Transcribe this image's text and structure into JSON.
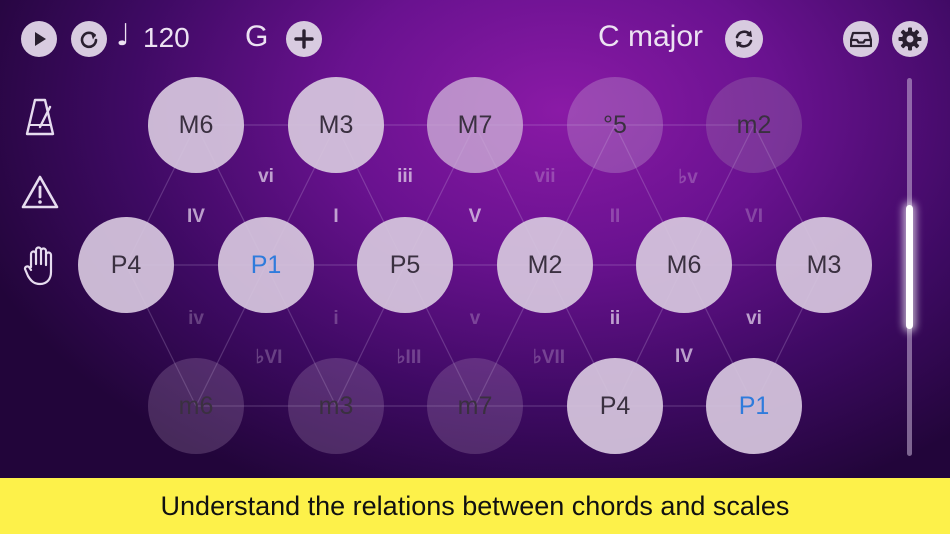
{
  "toolbar": {
    "tempo_symbol": "♩",
    "tempo": "120",
    "key_note": "G",
    "add_symbol": "+",
    "scale_name": "C major"
  },
  "icons": {
    "play": "play-icon",
    "loop": "loop-icon",
    "add": "plus-icon",
    "swap": "swap-icon",
    "tray": "tray-icon",
    "settings": "gear-icon",
    "metronome": "metronome-icon",
    "warning": "warning-icon",
    "hand": "hand-icon"
  },
  "grid": {
    "row1": [
      "M6",
      "M3",
      "M7",
      "°5",
      "m2"
    ],
    "row2": [
      "P4",
      "P1",
      "P5",
      "M2",
      "M6",
      "M3"
    ],
    "row3": [
      "m6",
      "m3",
      "m7",
      "P4",
      "P1"
    ],
    "chords_upper": [
      "vi",
      "iii",
      "vii",
      "♭v"
    ],
    "chords_mid_upper": [
      "IV",
      "I",
      "V",
      "II",
      "VI"
    ],
    "chords_mid_lower": [
      "iv",
      "i",
      "v",
      "ii",
      "vi"
    ],
    "chords_lower": [
      "♭VI",
      "♭III",
      "♭VII",
      "IV"
    ]
  },
  "caption": "Understand the relations between chords and scales",
  "colors": {
    "background_center": "#8a1aa6",
    "background_edge": "#22053a",
    "root_highlight": "#2f7bdc",
    "caption_bar": "#fdf14a"
  }
}
